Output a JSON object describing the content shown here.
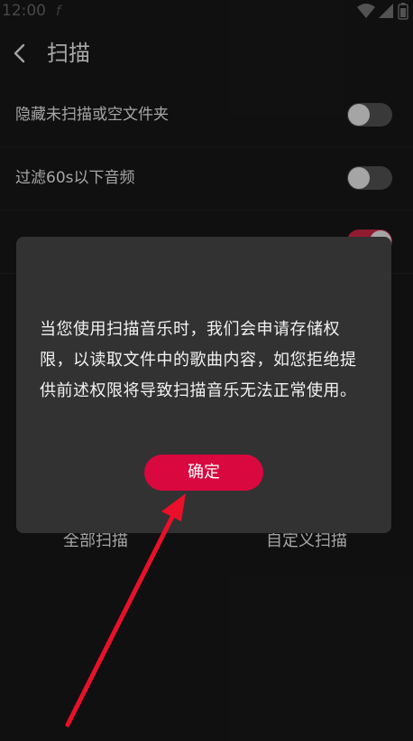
{
  "status_bar": {
    "time": "12:00",
    "notification_glyph": "f",
    "icons": [
      "wifi-icon",
      "signal-icon",
      "battery-icon"
    ]
  },
  "header": {
    "title": "扫描",
    "back_icon": "chevron-left-icon"
  },
  "settings": [
    {
      "label": "隐藏未扫描或空文件夹",
      "enabled": false
    },
    {
      "label": "过滤60s以下音频",
      "enabled": false
    },
    {
      "label": "",
      "enabled": true
    }
  ],
  "actions": {
    "scan_all": "全部扫描",
    "custom_scan": "自定义扫描"
  },
  "dialog": {
    "message": "当您使用扫描音乐时，我们会申请存储权限，以读取文件中的歌曲内容，如您拒绝提供前述权限将导致扫描音乐无法正常使用。",
    "confirm": "确定"
  },
  "colors": {
    "background": "#191919",
    "dialog": "#323232",
    "accent": "#d9083f",
    "toggle_on": "#d52a4a",
    "annotation_arrow": "#e8102a"
  }
}
